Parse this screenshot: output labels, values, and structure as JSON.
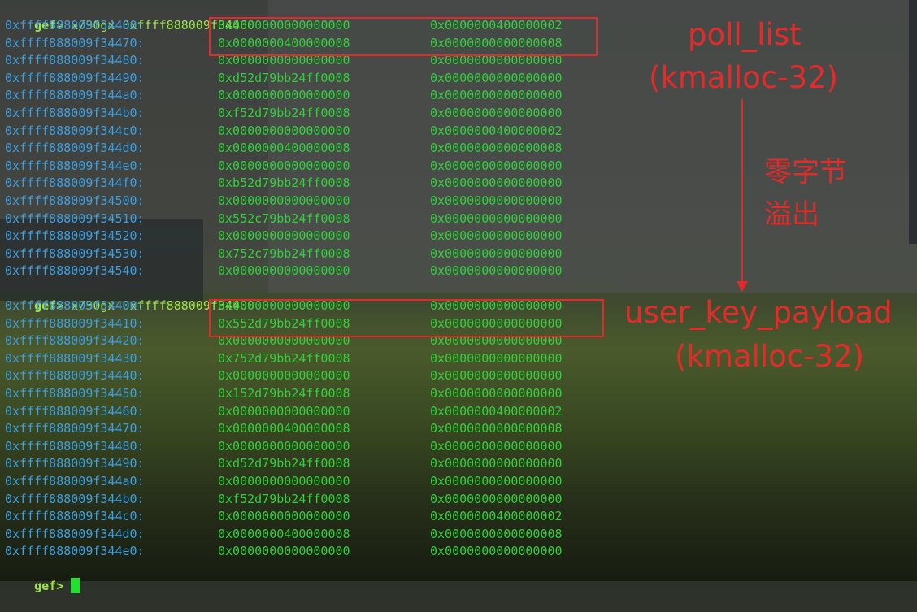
{
  "prompt": "gef>",
  "commands": [
    "x/30gx 0xffff888009f34460",
    "x/30gx 0xffff888009f34400"
  ],
  "dump1": [
    [
      "0xffff888009f34460:",
      "0x0000000000000000",
      "0x0000000400000002"
    ],
    [
      "0xffff888009f34470:",
      "0x0000000400000008",
      "0x0000000000000008"
    ],
    [
      "0xffff888009f34480:",
      "0x0000000000000000",
      "0x0000000000000000"
    ],
    [
      "0xffff888009f34490:",
      "0xd52d79bb24ff0008",
      "0x0000000000000000"
    ],
    [
      "0xffff888009f344a0:",
      "0x0000000000000000",
      "0x0000000000000000"
    ],
    [
      "0xffff888009f344b0:",
      "0xf52d79bb24ff0008",
      "0x0000000000000000"
    ],
    [
      "0xffff888009f344c0:",
      "0x0000000000000000",
      "0x0000000400000002"
    ],
    [
      "0xffff888009f344d0:",
      "0x0000000400000008",
      "0x0000000000000008"
    ],
    [
      "0xffff888009f344e0:",
      "0x0000000000000000",
      "0x0000000000000000"
    ],
    [
      "0xffff888009f344f0:",
      "0xb52d79bb24ff0008",
      "0x0000000000000000"
    ],
    [
      "0xffff888009f34500:",
      "0x0000000000000000",
      "0x0000000000000000"
    ],
    [
      "0xffff888009f34510:",
      "0x552c79bb24ff0008",
      "0x0000000000000000"
    ],
    [
      "0xffff888009f34520:",
      "0x0000000000000000",
      "0x0000000000000000"
    ],
    [
      "0xffff888009f34530:",
      "0x752c79bb24ff0008",
      "0x0000000000000000"
    ],
    [
      "0xffff888009f34540:",
      "0x0000000000000000",
      "0x0000000000000000"
    ]
  ],
  "dump2": [
    [
      "0xffff888009f34400:",
      "0x0000000000000000",
      "0x0000000000000000"
    ],
    [
      "0xffff888009f34410:",
      "0x552d79bb24ff0008",
      "0x0000000000000000"
    ],
    [
      "0xffff888009f34420:",
      "0x0000000000000000",
      "0x0000000000000000"
    ],
    [
      "0xffff888009f34430:",
      "0x752d79bb24ff0008",
      "0x0000000000000000"
    ],
    [
      "0xffff888009f34440:",
      "0x0000000000000000",
      "0x0000000000000000"
    ],
    [
      "0xffff888009f34450:",
      "0x152d79bb24ff0008",
      "0x0000000000000000"
    ],
    [
      "0xffff888009f34460:",
      "0x0000000000000000",
      "0x0000000400000002"
    ],
    [
      "0xffff888009f34470:",
      "0x0000000400000008",
      "0x0000000000000008"
    ],
    [
      "0xffff888009f34480:",
      "0x0000000000000000",
      "0x0000000000000000"
    ],
    [
      "0xffff888009f34490:",
      "0xd52d79bb24ff0008",
      "0x0000000000000000"
    ],
    [
      "0xffff888009f344a0:",
      "0x0000000000000000",
      "0x0000000000000000"
    ],
    [
      "0xffff888009f344b0:",
      "0xf52d79bb24ff0008",
      "0x0000000000000000"
    ],
    [
      "0xffff888009f344c0:",
      "0x0000000000000000",
      "0x0000000400000002"
    ],
    [
      "0xffff888009f344d0:",
      "0x0000000400000008",
      "0x0000000000000008"
    ],
    [
      "0xffff888009f344e0:",
      "0x0000000000000000",
      "0x0000000000000000"
    ]
  ],
  "annotations": {
    "top_label": "poll_list",
    "top_sub": "(kmalloc-32)",
    "middle_line1": "零字节",
    "middle_line2": "溢出",
    "bottom_label": "user_key_payload",
    "bottom_sub": "(kmalloc-32)"
  },
  "colors": {
    "prompt": "#9be34a",
    "address": "#3f9fe0",
    "value": "#2fd23a",
    "annotation": "#e52a2a"
  }
}
